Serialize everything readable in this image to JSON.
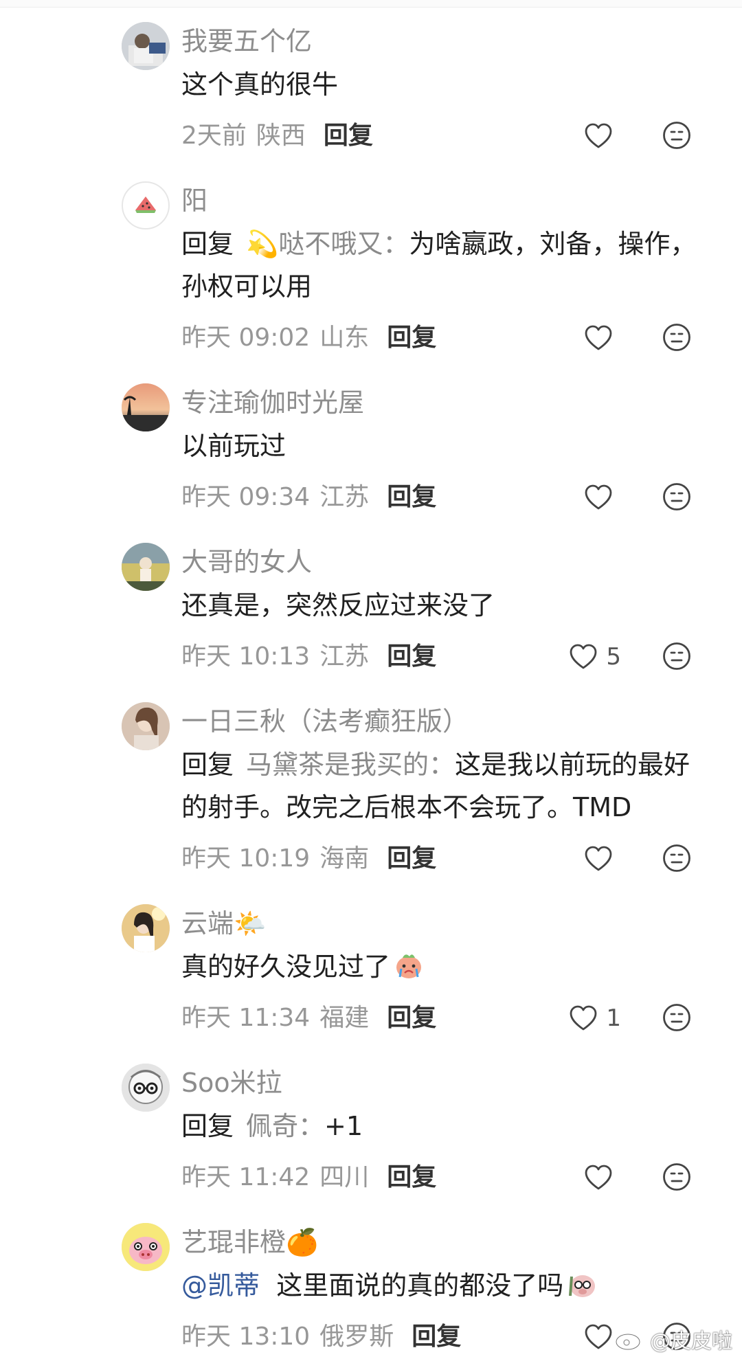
{
  "comments": [
    {
      "username": "我要五个亿",
      "reply_prefix": "",
      "reply_target": "",
      "mention": "",
      "text": "这个真的很牛",
      "time": "2天前",
      "location": "陕西",
      "reply_label": "回复",
      "likes": ""
    },
    {
      "username": "阳",
      "reply_prefix": "回复",
      "reply_target": "💫哒不哦又：",
      "mention": "",
      "text": "为啥嬴政，刘备，操作，孙权可以用",
      "time": "昨天 09:02",
      "location": "山东",
      "reply_label": "回复",
      "likes": ""
    },
    {
      "username": "专注瑜伽时光屋",
      "reply_prefix": "",
      "reply_target": "",
      "mention": "",
      "text": "以前玩过",
      "time": "昨天 09:34",
      "location": "江苏",
      "reply_label": "回复",
      "likes": ""
    },
    {
      "username": "大哥的女人",
      "reply_prefix": "",
      "reply_target": "",
      "mention": "",
      "text": "还真是，突然反应过来没了",
      "time": "昨天 10:13",
      "location": "江苏",
      "reply_label": "回复",
      "likes": "5"
    },
    {
      "username": "一日三秋（法考癫狂版）",
      "reply_prefix": "回复",
      "reply_target": "马黛茶是我买的：",
      "mention": "",
      "text": "这是我以前玩的最好的射手。改完之后根本不会玩了。TMD",
      "time": "昨天 10:19",
      "location": "海南",
      "reply_label": "回复",
      "likes": ""
    },
    {
      "username": "云端🌤️",
      "reply_prefix": "",
      "reply_target": "",
      "mention": "",
      "text": "真的好久没见过了",
      "time": "昨天 11:34",
      "location": "福建",
      "reply_label": "回复",
      "likes": "1"
    },
    {
      "username": "Soo米拉",
      "reply_prefix": "回复",
      "reply_target": "佩奇：",
      "mention": "",
      "text": "+1",
      "time": "昨天 11:42",
      "location": "四川",
      "reply_label": "回复",
      "likes": ""
    },
    {
      "username": "艺琨非橙🍊",
      "reply_prefix": "",
      "reply_target": "",
      "mention": "@凯蒂",
      "text": "这里面说的真的都没了吗",
      "time": "昨天 13:10",
      "location": "俄罗斯",
      "reply_label": "回复",
      "likes": ""
    }
  ],
  "watermark": "@皮皮啦",
  "icons": {
    "like": "heart-outline-icon",
    "react": "neutral-face-icon",
    "watermark": "weibo-logo-icon"
  },
  "colors": {
    "username": "#8d8d8d",
    "meta": "#979797",
    "mention": "#355a9c",
    "text": "#202020"
  }
}
